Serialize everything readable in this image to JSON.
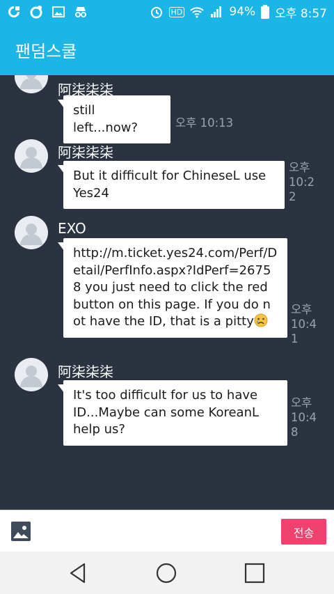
{
  "status": {
    "battery": "94%",
    "time": "오후 8:57",
    "hd": "HD"
  },
  "app": {
    "title": "팬덤스쿨"
  },
  "messages": [
    {
      "sender": "阿柒柒柒",
      "text": "still left...now?",
      "time": "오후 10:13"
    },
    {
      "sender": "阿柒柒柒",
      "text": "But it difficult for ChineseL use Yes24",
      "time": "오후 10:22"
    },
    {
      "sender": "EXO",
      "text": "http://m.ticket.yes24.com/Perf/Detail/PerfInfo.aspx?IdPerf=26758  you just need to click the red button on this page. If you do not have the ID, that is a pitty",
      "time": "오후 10:41"
    },
    {
      "sender": "阿柒柒柒",
      "text": "It's too difficult for us to have ID...Maybe can some KoreanL help us?",
      "time": "오후 10:48"
    }
  ],
  "input": {
    "send_label": "전송"
  },
  "icons": {
    "image": "image-icon",
    "back": "back-triangle-icon",
    "home": "home-circle-icon",
    "recents": "recents-square-icon",
    "emoji": "crying-face-emoji"
  }
}
